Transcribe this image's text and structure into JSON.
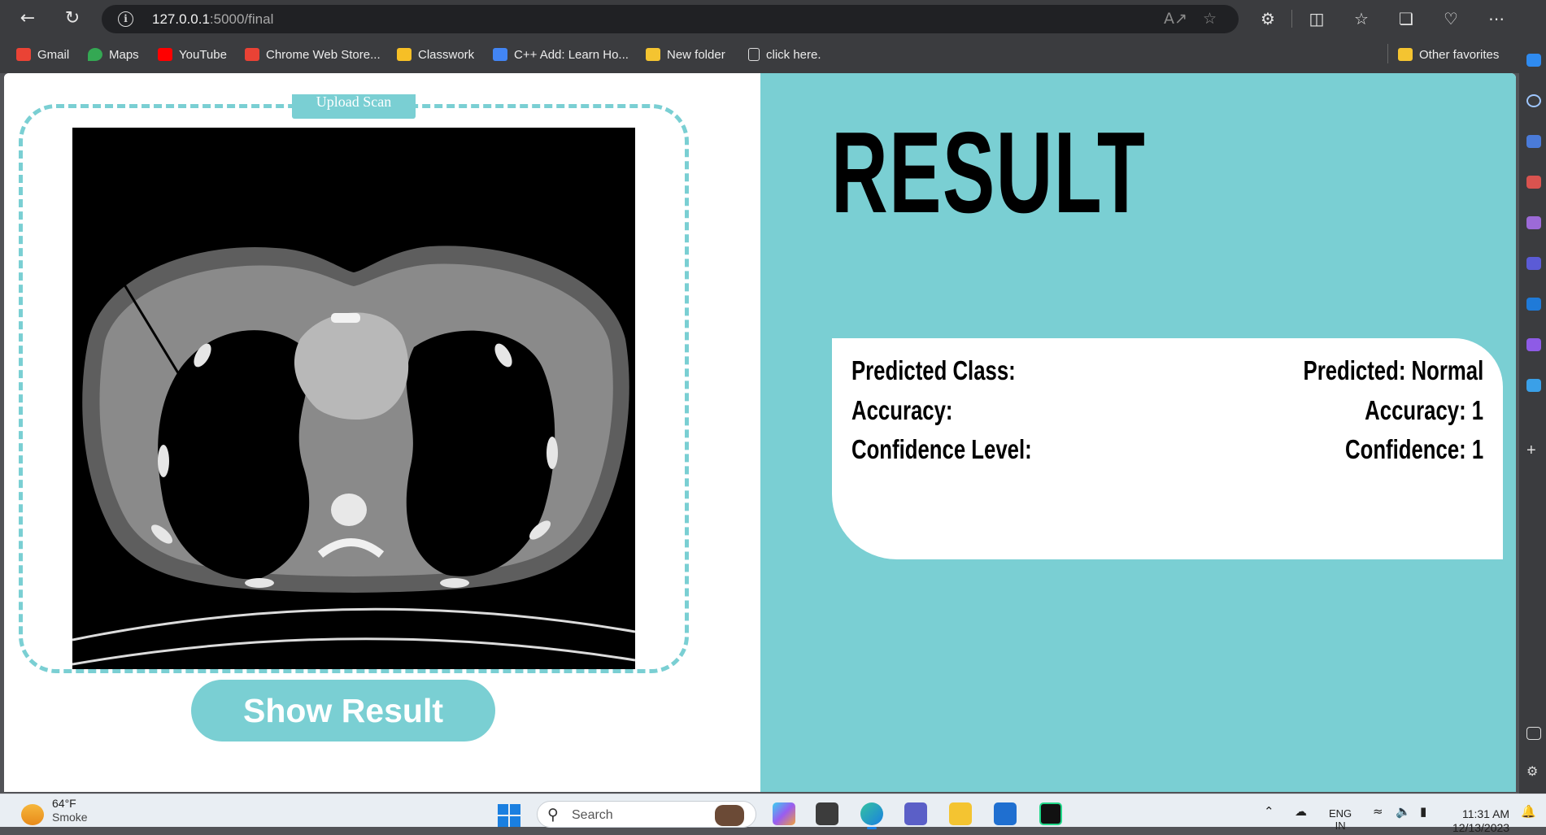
{
  "browser": {
    "url_host": "127.0.0.1",
    "url_path": ":5000/final",
    "bookmarks": [
      {
        "label": "Gmail",
        "icon": "gmail-icon",
        "color": "#ea4335"
      },
      {
        "label": "Maps",
        "icon": "maps-icon",
        "color": "#34a853"
      },
      {
        "label": "YouTube",
        "icon": "youtube-icon",
        "color": "#ff0000"
      },
      {
        "label": "Chrome Web Store...",
        "icon": "chrome-web-store-icon",
        "color": "#e94235"
      },
      {
        "label": "Classwork",
        "icon": "classwork-icon",
        "color": "#f6bf26"
      },
      {
        "label": "C++ Add: Learn Ho...",
        "icon": "cpp-icon",
        "color": "#4285f4"
      },
      {
        "label": "New folder",
        "icon": "folder-icon",
        "color": "#f4c431"
      },
      {
        "label": "click here.",
        "icon": "page-icon",
        "color": "#dddddd"
      }
    ],
    "other_favorites": "Other favorites"
  },
  "page": {
    "upload_button": "Upload Scan",
    "show_result_button": "Show Result",
    "result_title": "RESULT",
    "rows": [
      {
        "label": "Predicted Class:",
        "value": "Predicted: Normal"
      },
      {
        "label": "Accuracy:",
        "value": "Accuracy: 1"
      },
      {
        "label": "Confidence Level:",
        "value": "Confidence: 1"
      }
    ],
    "accent_color": "#7acfd3"
  },
  "taskbar": {
    "temperature": "64°F",
    "weather_text": "Smoke",
    "search_placeholder": "Search",
    "language": "ENG",
    "language_sub": "IN",
    "time": "11:31 AM",
    "date": "12/13/2023"
  }
}
